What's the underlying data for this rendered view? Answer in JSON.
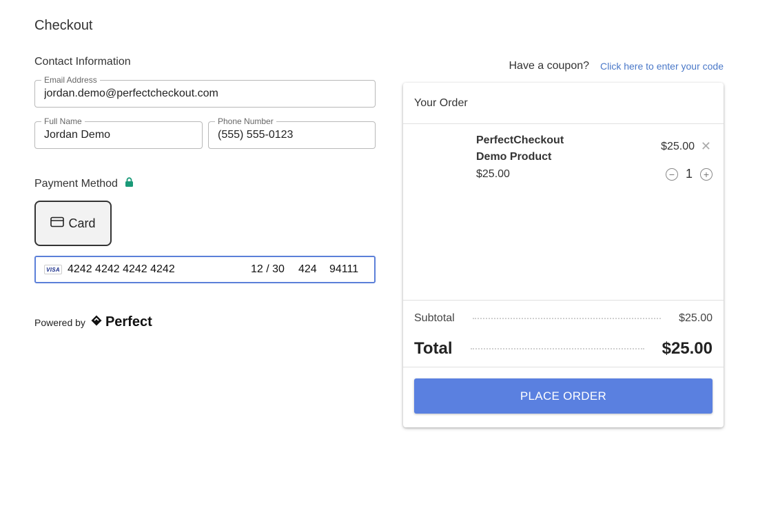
{
  "page": {
    "title": "Checkout"
  },
  "contact": {
    "heading": "Contact Information",
    "email_label": "Email Address",
    "email_value": "jordan.demo@perfectcheckout.com",
    "name_label": "Full Name",
    "name_value": "Jordan Demo",
    "phone_label": "Phone Number",
    "phone_value": "(555) 555-0123"
  },
  "payment": {
    "heading": "Payment Method",
    "lock_icon": "lock-icon",
    "method_label": "Card",
    "card_brand": "VISA",
    "card_number": "4242 4242 4242 4242",
    "expiry": "12 / 30",
    "cvc": "424",
    "zip": "94111"
  },
  "powered": {
    "text": "Powered by",
    "brand": "Perfect"
  },
  "coupon": {
    "question": "Have a coupon?",
    "link": "Click here to enter your code"
  },
  "order": {
    "heading": "Your Order",
    "product_name": "PerfectCheckout Demo Product",
    "unit_price": "$25.00",
    "line_price": "$25.00",
    "remove_glyph": "✕",
    "quantity": "1",
    "subtotal_label": "Subtotal",
    "subtotal_value": "$25.00",
    "total_label": "Total",
    "total_value": "$25.00",
    "place_order": "PLACE ORDER"
  },
  "colors": {
    "accent": "#5a80e0",
    "link": "#4a78c8",
    "lock": "#1a9a78"
  }
}
